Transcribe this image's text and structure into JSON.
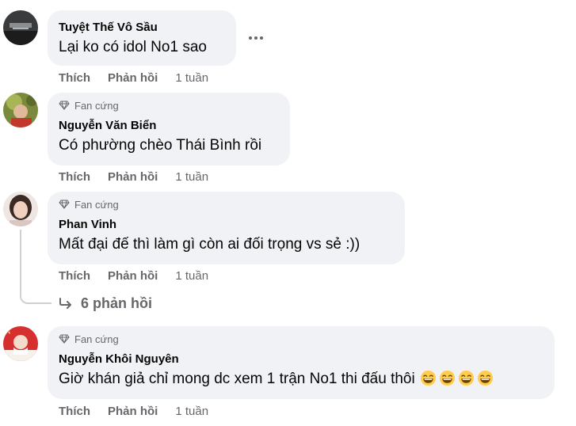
{
  "comments": [
    {
      "author": "Tuyệt Thế Vô Sầu",
      "text": "Lại ko có idol No1 sao",
      "like_label": "Thích",
      "reply_label": "Phản hồi",
      "time": "1 tuần",
      "avatar": "dark-grey-avatar"
    },
    {
      "badge": "Fan cứng",
      "author": "Nguyễn Văn Biển",
      "text": "Có phường chèo Thái Bình rồi",
      "like_label": "Thích",
      "reply_label": "Phản hồi",
      "time": "1 tuần",
      "avatar": "photo-avatar-green"
    },
    {
      "badge": "Fan cứng",
      "author": "Phan Vinh",
      "text": "Mất đại đế thì làm gì còn ai đối trọng vs sẻ :))",
      "like_label": "Thích",
      "reply_label": "Phản hồi",
      "time": "1 tuần",
      "avatar": "photo-avatar-portrait",
      "replies_label": "6 phản hồi"
    },
    {
      "badge": "Fan cứng",
      "author": "Nguyễn Khôi Nguyên",
      "text": "Giờ khán giả chỉ mong dc xem 1 trận No1 thi đấu thôi",
      "emoji": [
        "grinning-face-icon",
        "grinning-face-icon",
        "grinning-face-icon",
        "grinning-face-icon"
      ],
      "like_label": "Thích",
      "reply_label": "Phản hồi",
      "time": "1 tuần",
      "avatar": "red-avatar"
    }
  ],
  "colors": {
    "bubble": "#f0f2f5",
    "secondary_text": "#65676b",
    "primary_text": "#050505",
    "thread_line": "#ced0d4",
    "emoji": "#ffcc4d"
  },
  "icons": {
    "more": "more-options-icon",
    "badge": "diamond-icon",
    "replies": "reply-arrow-icon"
  }
}
